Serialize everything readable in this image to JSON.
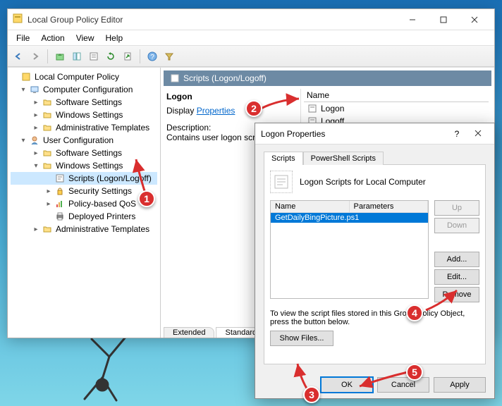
{
  "window": {
    "title": "Local Group Policy Editor",
    "menus": [
      "File",
      "Action",
      "View",
      "Help"
    ]
  },
  "tree": {
    "root": "Local Computer Policy",
    "comp": {
      "label": "Computer Configuration",
      "items": [
        "Software Settings",
        "Windows Settings",
        "Administrative Templates"
      ]
    },
    "user": {
      "label": "User Configuration",
      "software": "Software Settings",
      "windows": {
        "label": "Windows Settings",
        "scripts": "Scripts (Logon/Logoff)",
        "security": "Security Settings",
        "qos": "Policy-based QoS",
        "printers": "Deployed Printers"
      },
      "admin": "Administrative Templates"
    }
  },
  "detail": {
    "header": "Scripts (Logon/Logoff)",
    "left": {
      "title": "Logon",
      "display_label": "Display",
      "properties_link": "Properties",
      "description_label": "Description:",
      "description_text": "Contains user logon scripts."
    },
    "right": {
      "col": "Name",
      "items": [
        "Logon",
        "Logoff"
      ]
    },
    "tabs": [
      "Extended",
      "Standard"
    ]
  },
  "dialog": {
    "title": "Logon Properties",
    "tabs": [
      "Scripts",
      "PowerShell Scripts"
    ],
    "caption": "Logon Scripts for Local Computer",
    "cols": {
      "name": "Name",
      "params": "Parameters"
    },
    "row": {
      "name": "GetDailyBingPicture.ps1",
      "params": ""
    },
    "buttons": {
      "up": "Up",
      "down": "Down",
      "add": "Add...",
      "edit": "Edit...",
      "remove": "Remove",
      "show": "Show Files..."
    },
    "hint": "To view the script files stored in this Group Policy Object, press the button below.",
    "footer": {
      "ok": "OK",
      "cancel": "Cancel",
      "apply": "Apply"
    }
  },
  "annotations": {
    "a1": "1",
    "a2": "2",
    "a3": "3",
    "a4": "4",
    "a5": "5"
  }
}
